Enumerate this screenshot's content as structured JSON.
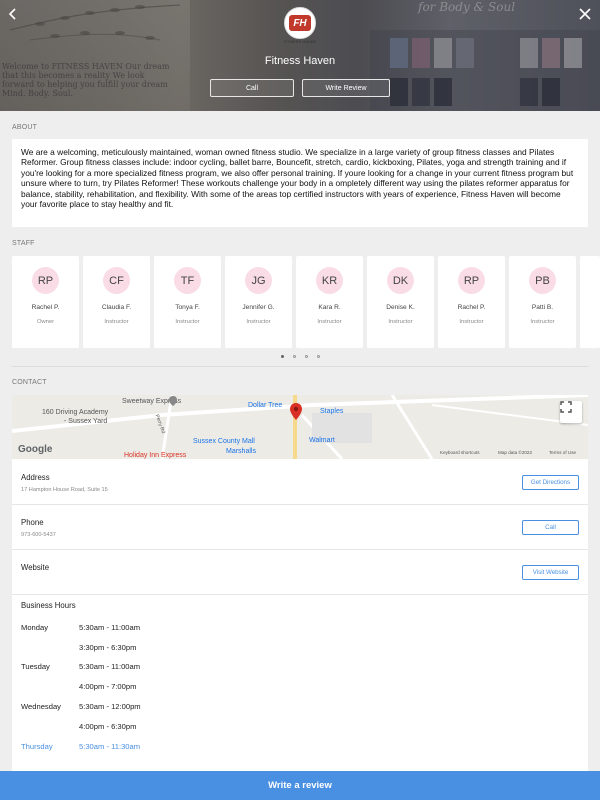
{
  "header": {
    "logo_caption": "FITNESS HAVEN",
    "title": "Fitness Haven",
    "call_label": "Call",
    "write_review_label": "Write Review",
    "background_quote": "Welcome to FITNESS HAVEN Our dream that this becomes a reality We look forward to helping you fulfill your dream Mind. Body. Soul.",
    "background_store_text": "for Body & Soul"
  },
  "about": {
    "section_label": "ABOUT",
    "text": "We are a welcoming, meticulously maintained, woman owned fitness studio. We specialize in a large variety of group fitness classes and Pilates Reformer.  Group fitness classes include: indoor cycling, ballet barre, Bouncefit, stretch, cardio, kickboxing, Pilates, yoga and strength training and if you're looking for a more specialized fitness program, we also offer personal training. If youre looking for a change in your current fitness program but unsure where to turn,  try Pilates Reformer!  These workouts challenge your body in a ompletely different way using the pilates reformer apparatus for balance, stability, rehabilitation, and flexibility. With some of the areas top certified instructors with years of experience, Fitness Haven will become your favorite place to stay healthy and fit."
  },
  "staff": {
    "section_label": "STAFF",
    "members": [
      {
        "initials": "RP",
        "name": "Rachel P.",
        "role": "Owner"
      },
      {
        "initials": "CF",
        "name": "Claudia F.",
        "role": "Instructor"
      },
      {
        "initials": "TF",
        "name": "Tonya F.",
        "role": "Instructor"
      },
      {
        "initials": "JG",
        "name": "Jennifer G.",
        "role": "Instructor"
      },
      {
        "initials": "KR",
        "name": "Kara R.",
        "role": "Instructor"
      },
      {
        "initials": "DK",
        "name": "Denise K.",
        "role": "Instructor"
      },
      {
        "initials": "RP",
        "name": "Rachel P.",
        "role": "Instructor"
      },
      {
        "initials": "PB",
        "name": "Patti B.",
        "role": "Instructor"
      }
    ],
    "page_count": 4,
    "active_page": 1
  },
  "contact": {
    "section_label": "CONTACT",
    "map": {
      "labels": {
        "sweetway": "Sweetway Express",
        "driving": "160 Driving Academy",
        "sussex_yard": "- Sussex Yard",
        "dollar_tree": "Dollar Tree",
        "staples": "Staples",
        "walmart": "Walmart",
        "sussex_mall": "Sussex County Mall",
        "marshalls": "Marshalls",
        "holiday_inn": "Holiday Inn Express",
        "perry": "Perry Rd",
        "google": "Google",
        "shortcuts": "Keyboard shortcuts",
        "map_data": "Map data ©2022",
        "terms": "Terms of Use"
      }
    },
    "address": {
      "label": "Address",
      "value": "17 Hampton House Road, Suite 15",
      "button": "Get Directions"
    },
    "phone": {
      "label": "Phone",
      "value": "973-600-5437",
      "button": "Call"
    },
    "website": {
      "label": "Website",
      "button": "Visit Website"
    },
    "hours": {
      "title": "Business Hours",
      "rows": [
        {
          "day": "Monday",
          "time": "5:30am - 11:00am"
        },
        {
          "day": "",
          "time": "3:30pm - 6:30pm"
        },
        {
          "day": "Tuesday",
          "time": "5:30am - 11:00am"
        },
        {
          "day": "",
          "time": "4:00pm - 7:00pm"
        },
        {
          "day": "Wednesday",
          "time": "5:30am - 12:00pm"
        },
        {
          "day": "",
          "time": "4:00pm - 6:30pm"
        },
        {
          "day": "Thursday",
          "time": "5:30am - 11:30am"
        }
      ],
      "today": "Thursday"
    }
  },
  "footer": {
    "write_review_label": "Write a review"
  },
  "colors": {
    "accent": "#4a90e2",
    "avatar_bg": "#f9dce6",
    "pin": "#d93025"
  }
}
